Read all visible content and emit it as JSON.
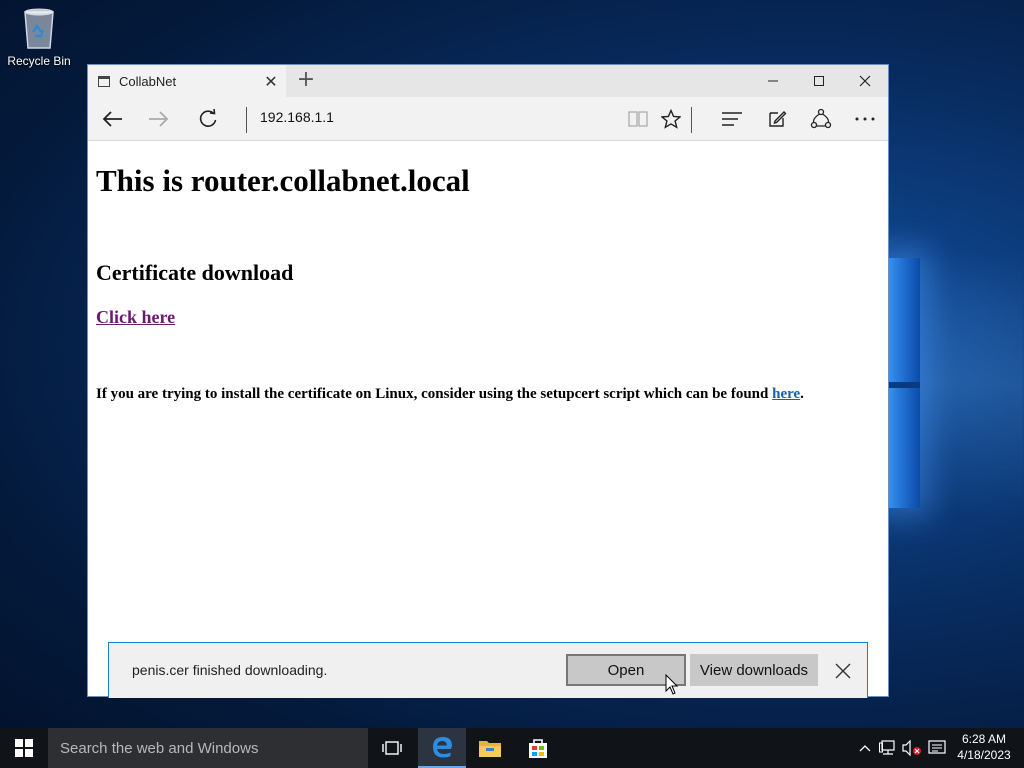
{
  "desktop": {
    "recycle_bin_label": "Recycle Bin"
  },
  "browser": {
    "tab_title": "CollabNet",
    "address": "192.168.1.1",
    "page": {
      "heading": "This is router.collabnet.local",
      "subheading": "Certificate download",
      "click_link": "Click here",
      "info_text": "If you are trying to install the certificate on Linux, consider using the setupcert script which can be found ",
      "info_link": "here",
      "info_end": "."
    },
    "download_bar": {
      "message": "penis.cer finished downloading.",
      "open_label": "Open",
      "view_downloads_label": "View downloads"
    }
  },
  "taskbar": {
    "search_placeholder": "Search the web and Windows",
    "time": "6:28 AM",
    "date": "4/18/2023"
  },
  "colors": {
    "visited_link": "#6a1b6e",
    "link": "#1a5fa8",
    "edge_blue": "#1a7fd0"
  }
}
